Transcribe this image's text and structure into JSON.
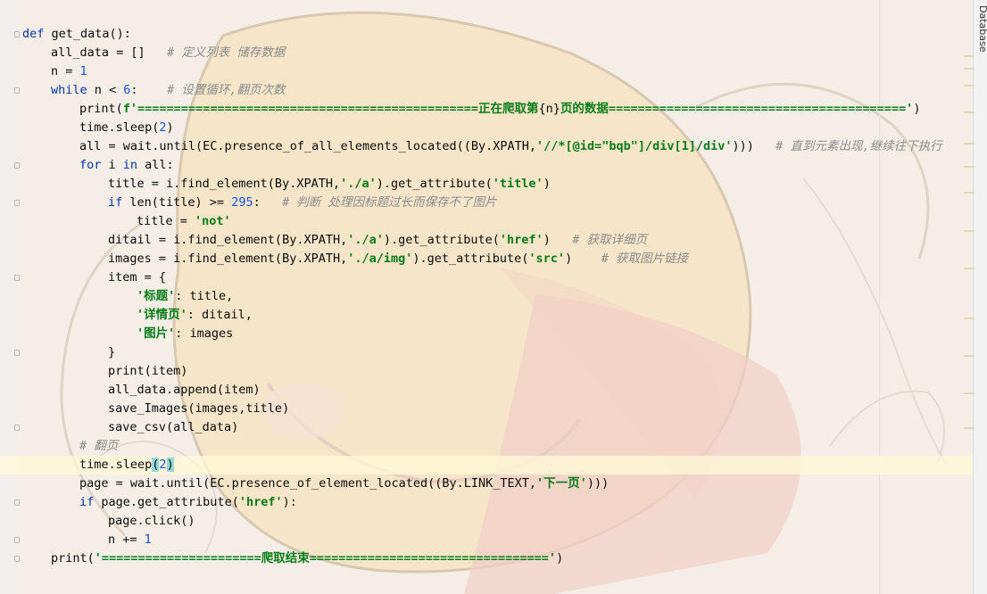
{
  "editor": {
    "side_tab": "Database",
    "lines": [
      {
        "indent": 0,
        "fold": true,
        "tokens": [
          [
            "kw",
            "def"
          ],
          [
            "t",
            " get_data():"
          ]
        ]
      },
      {
        "indent": 1,
        "tokens": [
          [
            "t",
            "all_data = []   "
          ],
          [
            "cmt",
            "# 定义列表 储存数据"
          ]
        ]
      },
      {
        "indent": 1,
        "tokens": [
          [
            "t",
            "n = "
          ],
          [
            "num",
            "1"
          ]
        ]
      },
      {
        "indent": 1,
        "fold": true,
        "tokens": [
          [
            "kw",
            "while"
          ],
          [
            "t",
            " n < "
          ],
          [
            "num",
            "6"
          ],
          [
            "t",
            ":    "
          ],
          [
            "cmt",
            "# 设置循环,翻页次数"
          ]
        ]
      },
      {
        "indent": 2,
        "tokens": [
          [
            "t",
            "print("
          ],
          [
            "fs",
            "f'===============================================正在爬取第"
          ],
          [
            "t",
            "{n}"
          ],
          [
            "fs",
            "页的数据========================================='"
          ],
          [
            "t",
            ")"
          ]
        ]
      },
      {
        "indent": 2,
        "tokens": [
          [
            "t",
            "time.sleep("
          ],
          [
            "num",
            "2"
          ],
          [
            "t",
            ")"
          ]
        ]
      },
      {
        "indent": 2,
        "tokens": [
          [
            "t",
            "all = wait.until(EC.presence_of_all_elements_located((By.XPATH,"
          ],
          [
            "str",
            "'//*[@id=\"bqb\"]/div[1]/div'"
          ],
          [
            "t",
            ")))   "
          ],
          [
            "cmt",
            "# 直到元素出现,继续往下执行"
          ]
        ]
      },
      {
        "indent": 2,
        "fold": true,
        "tokens": [
          [
            "kw",
            "for"
          ],
          [
            "t",
            " i "
          ],
          [
            "kw",
            "in"
          ],
          [
            "t",
            " all:"
          ]
        ]
      },
      {
        "indent": 3,
        "tokens": [
          [
            "t",
            "title = i.find_element(By.XPATH,"
          ],
          [
            "str",
            "'./a'"
          ],
          [
            "t",
            ").get_attribute("
          ],
          [
            "str",
            "'title'"
          ],
          [
            "t",
            ")"
          ]
        ]
      },
      {
        "indent": 3,
        "fold": true,
        "tokens": [
          [
            "kw",
            "if"
          ],
          [
            "t",
            " len(title) >= "
          ],
          [
            "num",
            "295"
          ],
          [
            "t",
            ":   "
          ],
          [
            "cmt",
            "# 判断 处理因标题过长而保存不了图片"
          ]
        ]
      },
      {
        "indent": 4,
        "tokens": [
          [
            "t",
            "title = "
          ],
          [
            "str",
            "'not'"
          ]
        ]
      },
      {
        "indent": 3,
        "tokens": [
          [
            "t",
            "ditail = i.find_element(By.XPATH,"
          ],
          [
            "str",
            "'./a'"
          ],
          [
            "t",
            ").get_attribute("
          ],
          [
            "str",
            "'href'"
          ],
          [
            "t",
            ")   "
          ],
          [
            "cmt",
            "# 获取详细页"
          ]
        ]
      },
      {
        "indent": 3,
        "tokens": [
          [
            "t",
            "images = i.find_element(By.XPATH,"
          ],
          [
            "str",
            "'./a/img'"
          ],
          [
            "t",
            ").get_attribute("
          ],
          [
            "str",
            "'src'"
          ],
          [
            "t",
            ")    "
          ],
          [
            "cmt",
            "# 获取图片链接"
          ]
        ]
      },
      {
        "indent": 3,
        "fold": true,
        "tokens": [
          [
            "t",
            "item = {"
          ]
        ]
      },
      {
        "indent": 4,
        "tokens": [
          [
            "str",
            "'标题'"
          ],
          [
            "t",
            ": title,"
          ]
        ]
      },
      {
        "indent": 4,
        "tokens": [
          [
            "str",
            "'详情页'"
          ],
          [
            "t",
            ": ditail,"
          ]
        ]
      },
      {
        "indent": 4,
        "tokens": [
          [
            "str",
            "'图片'"
          ],
          [
            "t",
            ": images"
          ]
        ]
      },
      {
        "indent": 3,
        "fold": true,
        "tokens": [
          [
            "t",
            "}"
          ]
        ]
      },
      {
        "indent": 3,
        "tokens": [
          [
            "t",
            "print(item)"
          ]
        ]
      },
      {
        "indent": 3,
        "tokens": [
          [
            "t",
            "all_data.append(item)"
          ]
        ]
      },
      {
        "indent": 3,
        "tokens": [
          [
            "t",
            "save_Images(images,title)"
          ]
        ]
      },
      {
        "indent": 3,
        "fold": true,
        "tokens": [
          [
            "t",
            "save_csv(all_data)"
          ]
        ]
      },
      {
        "indent": 2,
        "tokens": [
          [
            "cmt",
            "# 翻页"
          ]
        ]
      },
      {
        "indent": 2,
        "current": true,
        "tokens": [
          [
            "t",
            "time.sleep"
          ],
          [
            "bm",
            "("
          ],
          [
            "num",
            "2"
          ],
          [
            "bm",
            ")"
          ]
        ]
      },
      {
        "indent": 2,
        "tokens": [
          [
            "t",
            "page = wait.until(EC.presence_of_element_located((By.LINK_TEXT,"
          ],
          [
            "str",
            "'下一页'"
          ],
          [
            "t",
            ")))"
          ]
        ]
      },
      {
        "indent": 2,
        "fold": true,
        "tokens": [
          [
            "kw",
            "if"
          ],
          [
            "t",
            " page.get_attribute("
          ],
          [
            "str",
            "'href'"
          ],
          [
            "t",
            "):"
          ]
        ]
      },
      {
        "indent": 3,
        "tokens": [
          [
            "t",
            "page.click()"
          ]
        ]
      },
      {
        "indent": 3,
        "fold": true,
        "tokens": [
          [
            "t",
            "n += "
          ],
          [
            "num",
            "1"
          ]
        ]
      },
      {
        "indent": 1,
        "fold": true,
        "tokens": [
          [
            "t",
            "print("
          ],
          [
            "str",
            "'======================爬取结束================================='"
          ],
          [
            "t",
            ")"
          ]
        ]
      }
    ]
  }
}
